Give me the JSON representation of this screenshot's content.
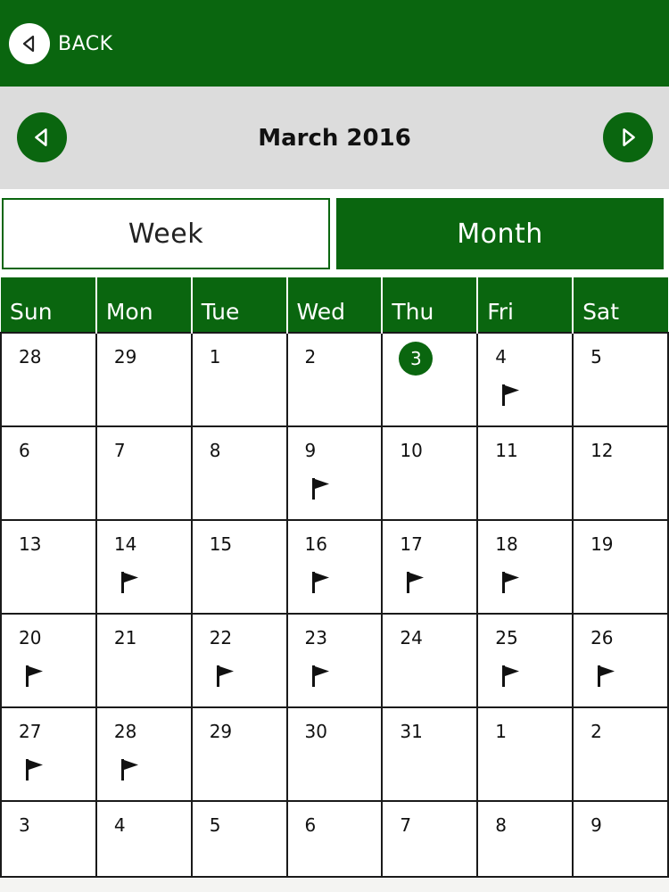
{
  "colors": {
    "brand_green": "#0a660f",
    "header_gray": "#dcdcdc",
    "grid_line": "#1a1a1a"
  },
  "header": {
    "back_label": "BACK",
    "back_icon": "chevron-left-icon"
  },
  "month_nav": {
    "title": "March 2016",
    "prev_icon": "chevron-left-icon",
    "next_icon": "chevron-right-icon"
  },
  "view_toggle": {
    "week_label": "Week",
    "month_label": "Month",
    "selected": "Month"
  },
  "calendar": {
    "weekdays": [
      "Sun",
      "Mon",
      "Tue",
      "Wed",
      "Thu",
      "Fri",
      "Sat"
    ],
    "weeks": [
      [
        {
          "day": "28",
          "flag": false,
          "today": false
        },
        {
          "day": "29",
          "flag": false,
          "today": false
        },
        {
          "day": "1",
          "flag": false,
          "today": false
        },
        {
          "day": "2",
          "flag": false,
          "today": false
        },
        {
          "day": "3",
          "flag": false,
          "today": true
        },
        {
          "day": "4",
          "flag": true,
          "today": false
        },
        {
          "day": "5",
          "flag": false,
          "today": false
        }
      ],
      [
        {
          "day": "6",
          "flag": false,
          "today": false
        },
        {
          "day": "7",
          "flag": false,
          "today": false
        },
        {
          "day": "8",
          "flag": false,
          "today": false
        },
        {
          "day": "9",
          "flag": true,
          "today": false
        },
        {
          "day": "10",
          "flag": false,
          "today": false
        },
        {
          "day": "11",
          "flag": false,
          "today": false
        },
        {
          "day": "12",
          "flag": false,
          "today": false
        }
      ],
      [
        {
          "day": "13",
          "flag": false,
          "today": false
        },
        {
          "day": "14",
          "flag": true,
          "today": false
        },
        {
          "day": "15",
          "flag": false,
          "today": false
        },
        {
          "day": "16",
          "flag": true,
          "today": false
        },
        {
          "day": "17",
          "flag": true,
          "today": false
        },
        {
          "day": "18",
          "flag": true,
          "today": false
        },
        {
          "day": "19",
          "flag": false,
          "today": false
        }
      ],
      [
        {
          "day": "20",
          "flag": true,
          "today": false
        },
        {
          "day": "21",
          "flag": false,
          "today": false
        },
        {
          "day": "22",
          "flag": true,
          "today": false
        },
        {
          "day": "23",
          "flag": true,
          "today": false
        },
        {
          "day": "24",
          "flag": false,
          "today": false
        },
        {
          "day": "25",
          "flag": true,
          "today": false
        },
        {
          "day": "26",
          "flag": true,
          "today": false
        }
      ],
      [
        {
          "day": "27",
          "flag": true,
          "today": false
        },
        {
          "day": "28",
          "flag": true,
          "today": false
        },
        {
          "day": "29",
          "flag": false,
          "today": false
        },
        {
          "day": "30",
          "flag": false,
          "today": false
        },
        {
          "day": "31",
          "flag": false,
          "today": false
        },
        {
          "day": "1",
          "flag": false,
          "today": false
        },
        {
          "day": "2",
          "flag": false,
          "today": false
        }
      ],
      [
        {
          "day": "3",
          "flag": false,
          "today": false
        },
        {
          "day": "4",
          "flag": false,
          "today": false
        },
        {
          "day": "5",
          "flag": false,
          "today": false
        },
        {
          "day": "6",
          "flag": false,
          "today": false
        },
        {
          "day": "7",
          "flag": false,
          "today": false
        },
        {
          "day": "8",
          "flag": false,
          "today": false
        },
        {
          "day": "9",
          "flag": false,
          "today": false
        }
      ]
    ]
  }
}
